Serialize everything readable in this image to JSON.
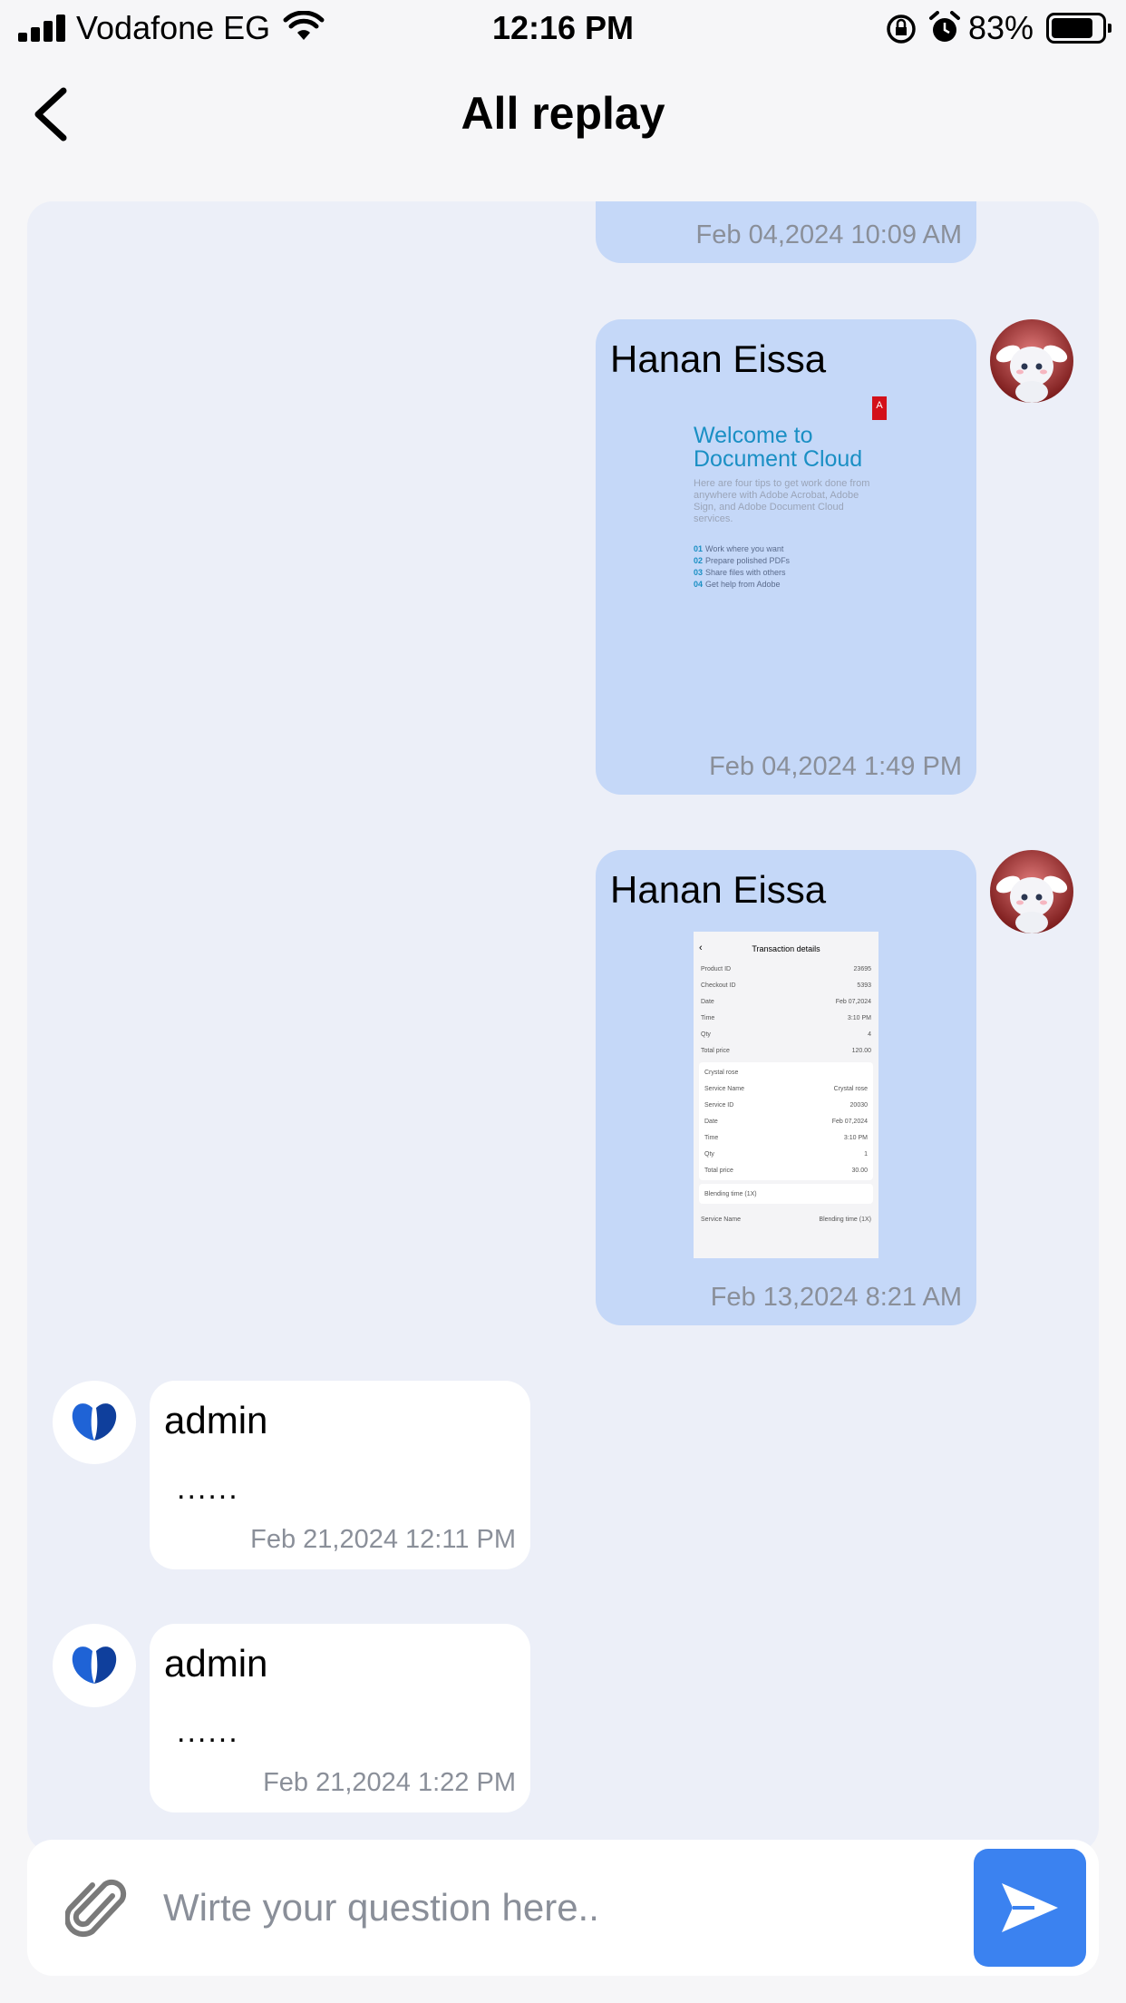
{
  "status_bar": {
    "carrier": "Vodafone EG",
    "time": "12:16 PM",
    "battery": "83%",
    "battery_level": 0.83
  },
  "nav": {
    "title": "All replay",
    "back_icon": "chevron-left-icon"
  },
  "messages": [
    {
      "type": "outgoing",
      "time": "Feb 04,2024 10:09 AM"
    },
    {
      "type": "outgoing",
      "sender": "Hanan Eissa",
      "attachment": {
        "title": "Welcome to Document Cloud",
        "body": "Here are four tips to get work done from anywhere with Adobe Acrobat, Adobe Sign, and Adobe Document Cloud services.",
        "tips": [
          {
            "num": "01",
            "text": "Work where you want"
          },
          {
            "num": "02",
            "text": "Prepare polished PDFs"
          },
          {
            "num": "03",
            "text": "Share files with others"
          },
          {
            "num": "04",
            "text": "Get help from Adobe"
          }
        ]
      },
      "time": "Feb 04,2024 1:49 PM"
    },
    {
      "type": "outgoing",
      "sender": "Hanan Eissa",
      "attachment": {
        "title": "Transaction details",
        "rows": [
          {
            "label": "Product ID",
            "value": "23695"
          },
          {
            "label": "Checkout ID",
            "value": "5393"
          },
          {
            "label": "Date",
            "value": "Feb 07,2024"
          },
          {
            "label": "Time",
            "value": "3:10 PM"
          },
          {
            "label": "Qty",
            "value": "4"
          },
          {
            "label": "Total price",
            "value": "120.00"
          }
        ],
        "card1_title": "Crystal rose",
        "card1_rows": [
          {
            "label": "Service Name",
            "value": "Crystal rose"
          },
          {
            "label": "Service ID",
            "value": "20030"
          },
          {
            "label": "Date",
            "value": "Feb 07,2024"
          },
          {
            "label": "Time",
            "value": "3:10 PM"
          },
          {
            "label": "Qty",
            "value": "1"
          },
          {
            "label": "Total price",
            "value": "30.00"
          }
        ],
        "card2_title": "Blending time (1X)",
        "card2_rows": [
          {
            "label": "Service Name",
            "value": "Blending time (1X)"
          }
        ]
      },
      "time": "Feb 13,2024 8:21 AM"
    },
    {
      "type": "incoming",
      "sender": "admin",
      "text": "......",
      "time": "Feb 21,2024 12:11 PM"
    },
    {
      "type": "incoming",
      "sender": "admin",
      "text": "......",
      "time": "Feb 21,2024 1:22 PM"
    }
  ],
  "composer": {
    "placeholder": "Wirte your question here..",
    "attach_icon": "paperclip-icon",
    "send_icon": "send-icon"
  },
  "colors": {
    "outgoing_bubble": "#c5d8f8",
    "incoming_bubble": "#ffffff",
    "chat_background": "#eceff8",
    "send_button": "#3b82f0"
  }
}
